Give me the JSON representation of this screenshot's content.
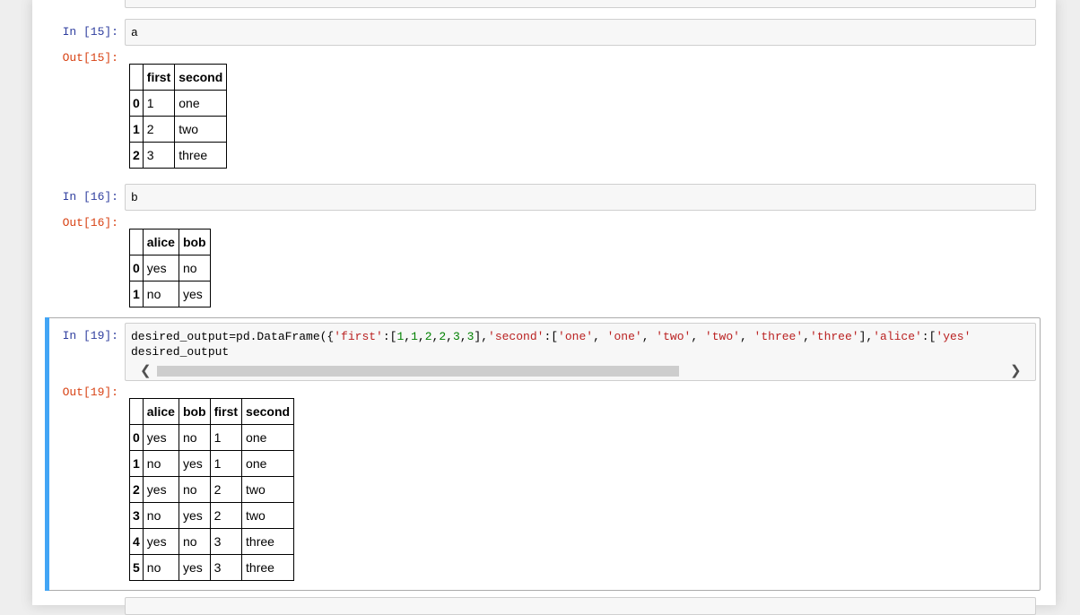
{
  "cells": [
    {
      "in_prompt": "In [15]:",
      "code": "a",
      "out_prompt": "Out[15]:",
      "table": {
        "columns": [
          "first",
          "second"
        ],
        "rows": [
          {
            "index": "0",
            "values": [
              "1",
              "one"
            ]
          },
          {
            "index": "1",
            "values": [
              "2",
              "two"
            ]
          },
          {
            "index": "2",
            "values": [
              "3",
              "three"
            ]
          }
        ]
      }
    },
    {
      "in_prompt": "In [16]:",
      "code": "b",
      "out_prompt": "Out[16]:",
      "table": {
        "columns": [
          "alice",
          "bob"
        ],
        "rows": [
          {
            "index": "0",
            "values": [
              "yes",
              "no"
            ]
          },
          {
            "index": "1",
            "values": [
              "no",
              "yes"
            ]
          }
        ]
      }
    },
    {
      "in_prompt": "In [19]:",
      "code_line1": {
        "t1": "desired_output=pd.DataFrame({",
        "t2": "'first'",
        "t3": ":[",
        "t4": "1",
        "t5": ",",
        "t6": "1",
        "t7": ",",
        "t8": "2",
        "t9": ",",
        "t10": "2",
        "t11": ",",
        "t12": "3",
        "t13": ",",
        "t14": "3",
        "t15": "],",
        "t16": "'second'",
        "t17": ":[",
        "t18": "'one'",
        "t19": ", ",
        "t20": "'one'",
        "t21": ", ",
        "t22": "'two'",
        "t23": ", ",
        "t24": "'two'",
        "t25": ", ",
        "t26": "'three'",
        "t27": ",",
        "t28": "'three'",
        "t29": "],",
        "t30": "'alice'",
        "t31": ":[",
        "t32": "'yes'"
      },
      "code_line2": "desired_output",
      "out_prompt": "Out[19]:",
      "table": {
        "columns": [
          "alice",
          "bob",
          "first",
          "second"
        ],
        "rows": [
          {
            "index": "0",
            "values": [
              "yes",
              "no",
              "1",
              "one"
            ]
          },
          {
            "index": "1",
            "values": [
              "no",
              "yes",
              "1",
              "one"
            ]
          },
          {
            "index": "2",
            "values": [
              "yes",
              "no",
              "2",
              "two"
            ]
          },
          {
            "index": "3",
            "values": [
              "no",
              "yes",
              "2",
              "two"
            ]
          },
          {
            "index": "4",
            "values": [
              "yes",
              "no",
              "3",
              "three"
            ]
          },
          {
            "index": "5",
            "values": [
              "no",
              "yes",
              "3",
              "three"
            ]
          }
        ]
      }
    }
  ],
  "colors": {
    "in_prompt": "#303f9f",
    "out_prompt": "#d84315",
    "selected_bar": "#42a5f5",
    "string": "#ba2121",
    "number": "#008000"
  },
  "icons": {
    "scroll_left": "chevron-left-icon",
    "scroll_right": "chevron-right-icon"
  }
}
